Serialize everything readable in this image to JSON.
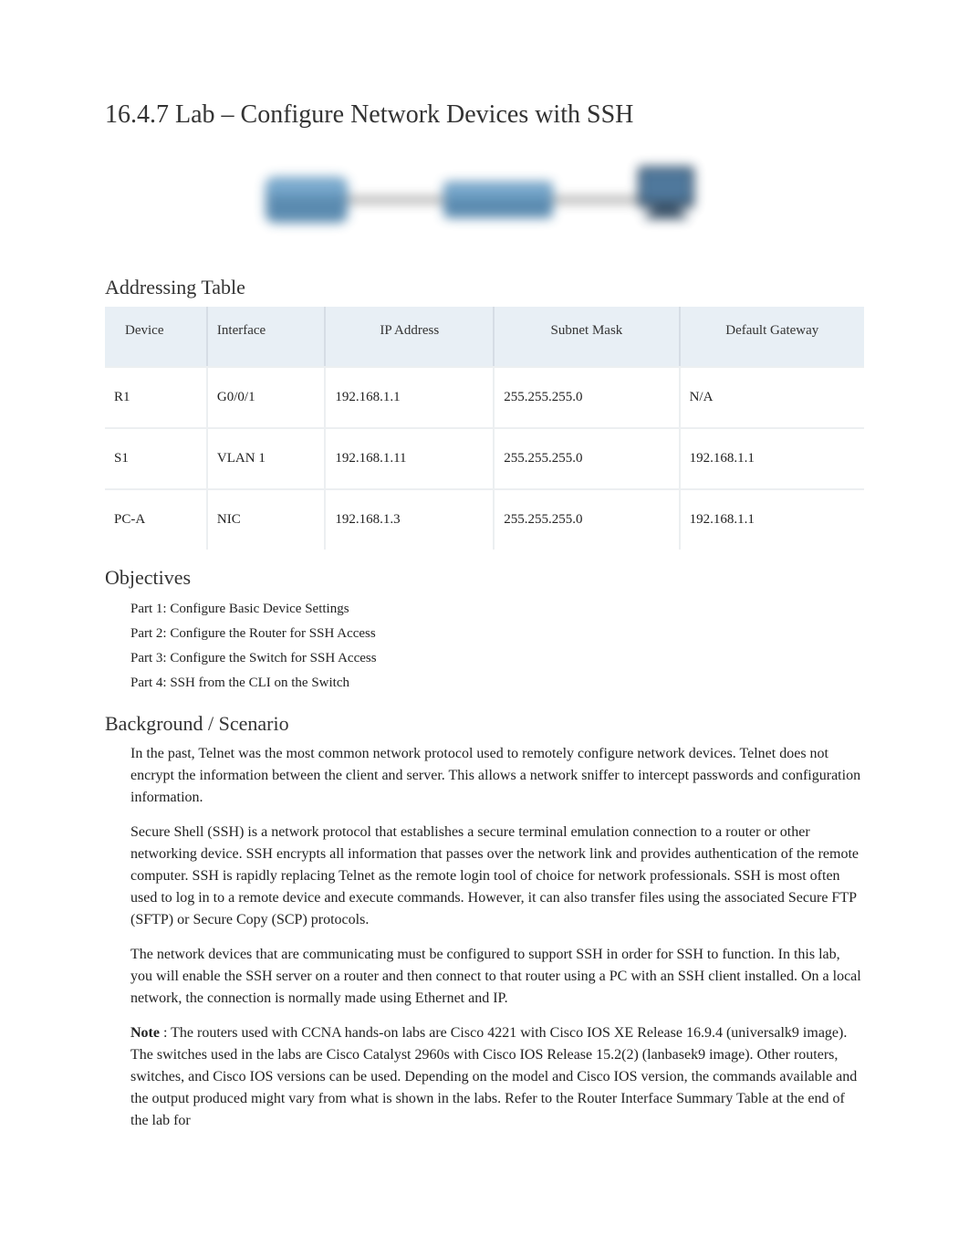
{
  "title": "16.4.7 Lab – Configure Network Devices with SSH",
  "sections": {
    "addressing": "Addressing Table",
    "objectives": "Objectives",
    "background": "Background / Scenario"
  },
  "table": {
    "headers": {
      "device": "Device",
      "interface": "Interface",
      "ip": "IP Address",
      "mask": "Subnet Mask",
      "gateway": "Default Gateway"
    },
    "rows趕": [],
    "rows": [
      {
        "device": "R1",
        "interface": "G0/0/1",
        "ip": "192.168.1.1",
        "mask": "255.255.255.0",
        "gateway": "N/A"
      },
      {
        "device": "S1",
        "interface": "VLAN 1",
        "ip": "192.168.1.11",
        "mask": "255.255.255.0",
        "gateway": "192.168.1.1"
      },
      {
        "device": "PC-A",
        "interface": "NIC",
        "ip": "192.168.1.3",
        "mask": "255.255.255.0",
        "gateway": "192.168.1.1"
      }
    ]
  },
  "objectives": [
    "Part 1: Configure Basic Device Settings",
    "Part 2: Configure the Router for SSH Access",
    "Part 3: Configure the Switch for SSH Access",
    "Part 4: SSH from the CLI on the Switch"
  ],
  "background": {
    "p1": "In the past, Telnet was the most common network protocol used to remotely configure network devices. Telnet does not encrypt the information between the client and server. This allows a network sniffer to intercept passwords and configuration information.",
    "p2": "Secure Shell (SSH) is a network protocol that establishes a secure terminal emulation connection to a router or other networking device. SSH encrypts all information that passes over the network link and provides authentication of the remote computer. SSH is rapidly replacing Telnet as the remote login tool of choice for network professionals. SSH is most often used to log in to a remote device and execute commands. However, it can also transfer files using the associated Secure FTP (SFTP) or Secure Copy (SCP) protocols.",
    "p3": "The network devices that are communicating must be configured to support SSH in order for SSH to function. In this lab, you will enable the SSH server on a router and then connect to that router using a PC with an SSH client installed. On a local network, the connection is normally made using Ethernet and IP.",
    "note_label": "Note",
    "note_rest": " : The routers used with CCNA hands-on labs are Cisco 4221 with Cisco IOS XE Release 16.9.4 (universalk9 image). The switches used in the labs are Cisco Catalyst 2960s with Cisco IOS Release 15.2(2) (lanbasek9 image). Other routers, switches, and Cisco IOS versions can be used. Depending on the model and Cisco IOS version, the commands available and the output produced might vary from what is shown in the labs. Refer to the Router Interface Summary Table at the end of the lab for"
  }
}
